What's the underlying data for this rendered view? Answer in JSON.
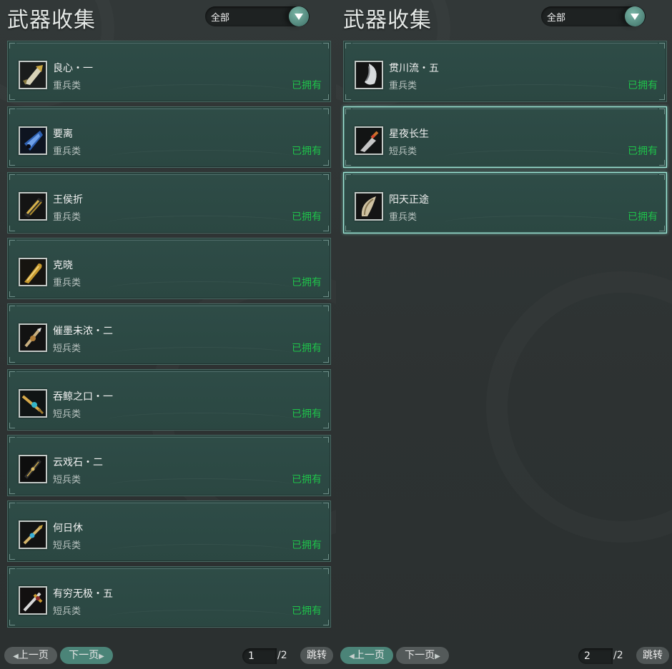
{
  "panels": [
    {
      "title": "武器收集",
      "filter": "全部",
      "items": [
        {
          "name": "良心・一",
          "type": "重兵类",
          "status": "已拥有",
          "icon": "heavy-axe-icon"
        },
        {
          "name": "要离",
          "type": "重兵类",
          "status": "已拥有",
          "icon": "blue-blade-icon"
        },
        {
          "name": "王侯折",
          "type": "重兵类",
          "status": "已拥有",
          "icon": "gold-claw-icon"
        },
        {
          "name": "克晓",
          "type": "重兵类",
          "status": "已拥有",
          "icon": "gold-broadsword-icon"
        },
        {
          "name": "催墨未浓・二",
          "type": "短兵类",
          "status": "已拥有",
          "icon": "ornate-dagger-icon"
        },
        {
          "name": "吞鲸之口・一",
          "type": "短兵类",
          "status": "已拥有",
          "icon": "teal-dagger-icon"
        },
        {
          "name": "云戏石・二",
          "type": "短兵类",
          "status": "已拥有",
          "icon": "dark-dagger-icon"
        },
        {
          "name": "何日休",
          "type": "短兵类",
          "status": "已拥有",
          "icon": "jeweled-dagger-icon"
        },
        {
          "name": "有穷无极・五",
          "type": "短兵类",
          "status": "已拥有",
          "icon": "golden-sword-icon"
        }
      ],
      "pager": {
        "prev": "上一页",
        "next": "下一页",
        "page": "1",
        "total": "/2",
        "jump": "跳转",
        "active": "next"
      }
    },
    {
      "title": "武器收集",
      "filter": "全部",
      "items": [
        {
          "name": "贯川流・五",
          "type": "重兵类",
          "status": "已拥有",
          "icon": "silver-blade-icon"
        },
        {
          "name": "星夜长生",
          "type": "短兵类",
          "status": "已拥有",
          "icon": "short-knife-icon",
          "selected": true
        },
        {
          "name": "阳天正途",
          "type": "重兵类",
          "status": "已拥有",
          "icon": "curved-blade-icon",
          "selected": true
        }
      ],
      "pager": {
        "prev": "上一页",
        "next": "下一页",
        "page": "2",
        "total": "/2",
        "jump": "跳转",
        "active": "prev"
      }
    }
  ],
  "colors": {
    "status_green": "#1fc24a",
    "card_bg": "#2d4a45",
    "accent_teal": "#4b8478"
  }
}
